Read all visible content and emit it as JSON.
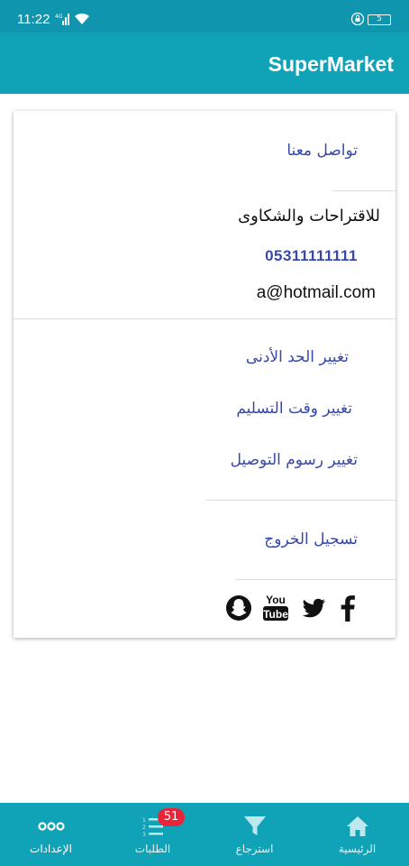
{
  "status_bar": {
    "time": "11:22",
    "battery": "5",
    "network_label": "4G"
  },
  "app_bar": {
    "title": "SuperMarket"
  },
  "card": {
    "contact_us": "تواصل معنا",
    "suggestions_label": "للاقتراحات والشكاوى",
    "phone": "05311111111",
    "email": "a@hotmail.com",
    "settings": [
      {
        "label": "تغيير الحد الأدنى"
      },
      {
        "label": "تغيير وقت التسليم"
      },
      {
        "label": "تغيير رسوم التوصيل"
      }
    ],
    "logout": "تسجيل الخروج",
    "social_icons": [
      "snapchat-icon",
      "youtube-icon",
      "twitter-icon",
      "facebook-icon"
    ]
  },
  "bottom_nav": {
    "items": [
      {
        "label": "الإعدادات",
        "icon": "more-dots-icon",
        "active": true
      },
      {
        "label": "الطلبات",
        "icon": "ordered-list-icon",
        "badge": "51"
      },
      {
        "label": "استرجاع",
        "icon": "filter-icon"
      },
      {
        "label": "الرئيسية",
        "icon": "home-icon"
      }
    ]
  },
  "colors": {
    "primary": "#10a3b7",
    "status_bar": "#0f95ad",
    "link": "#3748a8",
    "badge": "#e8253a"
  }
}
